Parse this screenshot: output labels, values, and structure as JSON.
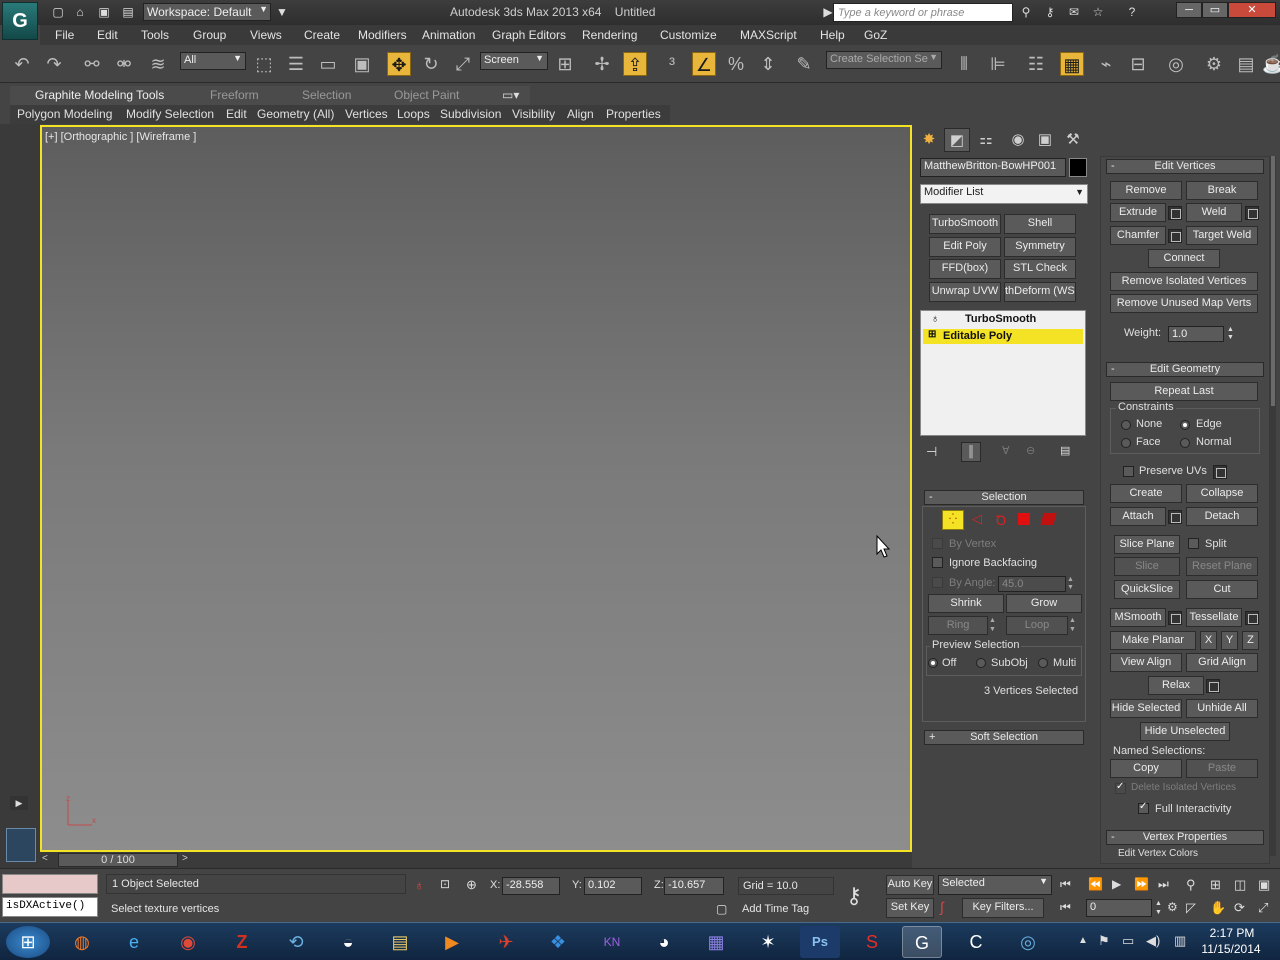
{
  "titlebar": {
    "workspace": "Workspace: Default",
    "app_title": "Autodesk 3ds Max  2013 x64",
    "doc_title": "Untitled",
    "search_placeholder": "Type a keyword or phrase"
  },
  "menubar": [
    "File",
    "Edit",
    "Tools",
    "Group",
    "Views",
    "Create",
    "Modifiers",
    "Animation",
    "Graph Editors",
    "Rendering",
    "Customize",
    "MAXScript",
    "Help",
    "GoZ"
  ],
  "toolbar": {
    "selection_filter": "All",
    "ref_coord": "Screen",
    "named_selection_placeholder": "Create Selection Se"
  },
  "ribbon": {
    "tabs": [
      "Graphite Modeling Tools",
      "Freeform",
      "Selection",
      "Object Paint"
    ],
    "panels": [
      "Polygon Modeling",
      "Modify Selection",
      "Edit",
      "Geometry (All)",
      "Vertices",
      "Loops",
      "Subdivision",
      "Visibility",
      "Align",
      "Properties"
    ]
  },
  "viewport": {
    "label": "[+] [Orthographic ] [Wireframe ]"
  },
  "command_panel": {
    "object_name": "MatthewBritton-BowHP001",
    "modifier_list": "Modifier List",
    "modifier_buttons": [
      "TurboSmooth",
      "Shell",
      "Edit Poly",
      "Symmetry",
      "FFD(box)",
      "STL Check",
      "Unwrap UVW",
      "thDeform (WSI"
    ],
    "stack": [
      {
        "name": "TurboSmooth",
        "selected": false
      },
      {
        "name": "Editable Poly",
        "selected": true
      }
    ],
    "selection": {
      "title": "Selection",
      "by_vertex": "By Vertex",
      "ignore_backfacing": "Ignore Backfacing",
      "by_angle": "By Angle:",
      "angle_value": "45.0",
      "shrink": "Shrink",
      "grow": "Grow",
      "ring": "Ring",
      "loop": "Loop",
      "preview_selection": "Preview Selection",
      "preview_off": "Off",
      "preview_subobj": "SubObj",
      "preview_multi": "Multi",
      "status": "3 Vertices Selected"
    },
    "soft_selection": "Soft Selection",
    "edit_vertices": {
      "title": "Edit Vertices",
      "remove": "Remove",
      "break": "Break",
      "extrude": "Extrude",
      "weld": "Weld",
      "chamfer": "Chamfer",
      "target_weld": "Target Weld",
      "connect": "Connect",
      "remove_isolated": "Remove Isolated Vertices",
      "remove_unused": "Remove Unused Map Verts",
      "weight_label": "Weight:",
      "weight_value": "1.0"
    },
    "edit_geometry": {
      "title": "Edit Geometry",
      "repeat_last": "Repeat Last",
      "constraints": "Constraints",
      "none": "None",
      "edge": "Edge",
      "face": "Face",
      "normal": "Normal",
      "preserve_uvs": "Preserve UVs",
      "create": "Create",
      "collapse": "Collapse",
      "attach": "Attach",
      "detach": "Detach",
      "slice_plane": "Slice Plane",
      "split": "Split",
      "slice": "Slice",
      "reset_plane": "Reset Plane",
      "quickslice": "QuickSlice",
      "cut": "Cut",
      "msmooth": "MSmooth",
      "tessellate": "Tessellate",
      "make_planar": "Make Planar",
      "x": "X",
      "y": "Y",
      "z": "Z",
      "view_align": "View Align",
      "grid_align": "Grid Align",
      "relax": "Relax",
      "hide_selected": "Hide Selected",
      "unhide_all": "Unhide All",
      "hide_unselected": "Hide Unselected",
      "named_selections": "Named Selections:",
      "copy": "Copy",
      "paste": "Paste",
      "delete_isolated": "Delete Isolated Vertices",
      "full_interactivity": "Full Interactivity"
    },
    "vertex_properties": {
      "title": "Vertex Properties",
      "edit_vertex_colors": "Edit Vertex Colors"
    }
  },
  "timeline": {
    "frame": "0 / 100"
  },
  "status": {
    "maxscript": "isDXActive()",
    "objects": "1 Object Selected",
    "prompt": "Select texture vertices",
    "x_label": "X:",
    "x": "-28.558",
    "y_label": "Y:",
    "y": "0.102",
    "z_label": "Z:",
    "z": "-10.657",
    "grid": "Grid = 10.0",
    "add_time_tag": "Add Time Tag",
    "auto_key": "Auto Key",
    "set_key": "Set Key",
    "key_selected": "Selected",
    "key_filters": "Key Filters...",
    "current_frame": "0"
  },
  "taskbar": {
    "time": "2:17 PM",
    "date": "11/15/2014"
  },
  "colors": {
    "accent": "#e8b63a",
    "viewport_border": "#f4e225",
    "stack_selected": "#f4e225"
  }
}
